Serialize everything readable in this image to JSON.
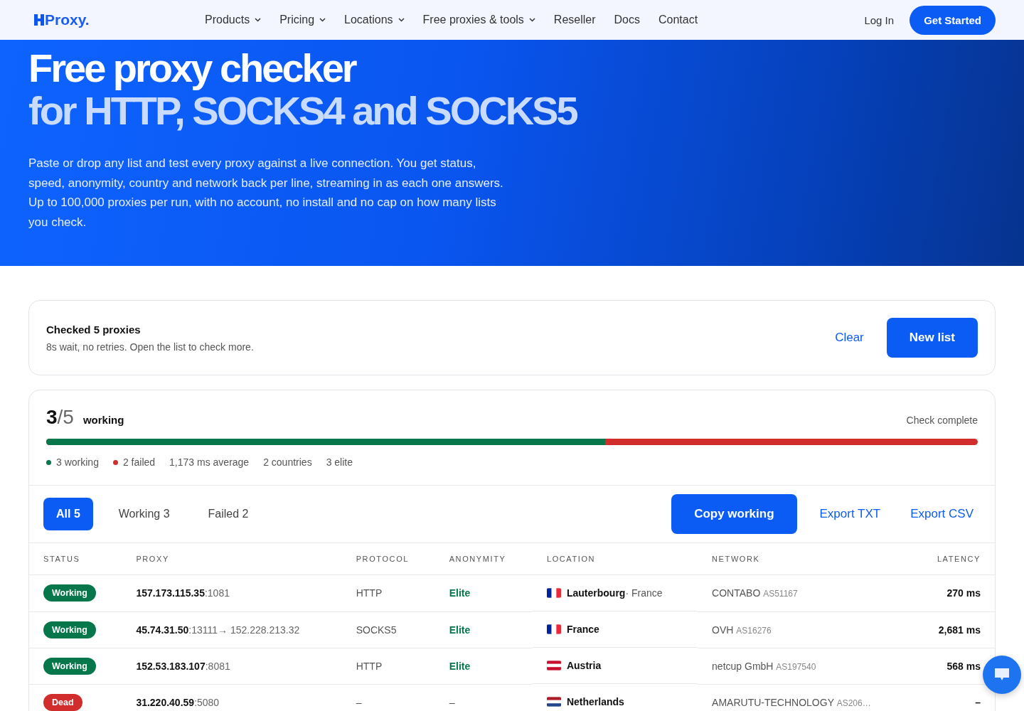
{
  "nav": {
    "logo": "Proxy.",
    "links": [
      {
        "label": "Products",
        "dropdown": true
      },
      {
        "label": "Pricing",
        "dropdown": true
      },
      {
        "label": "Locations",
        "dropdown": true
      },
      {
        "label": "Free proxies & tools",
        "dropdown": true
      },
      {
        "label": "Reseller",
        "dropdown": false
      },
      {
        "label": "Docs",
        "dropdown": false
      },
      {
        "label": "Contact",
        "dropdown": false
      }
    ],
    "login": "Log In",
    "cta": "Get Started"
  },
  "hero": {
    "title_line1": "Free proxy checker",
    "title_line2": "for HTTP, SOCKS4 and SOCKS5",
    "text": "Paste or drop any list and test every proxy against a live connection. You get status, speed, anonymity, country and network back per line, streaming in as each one answers. Up to 100,000 proxies per run, with no account, no install and no cap on how many lists you check."
  },
  "summary": {
    "title": "Checked 5 proxies",
    "subtitle": "8s wait, no retries. Open the list to check more.",
    "clear": "Clear",
    "new_list": "New list"
  },
  "results": {
    "count": "3",
    "total": "/5",
    "count_label": "working",
    "state": "Check complete",
    "level": 0.6,
    "stats": [
      {
        "text": "3 working",
        "color": "#06774a"
      },
      {
        "text": "2 failed",
        "color": "#d22d2d"
      },
      {
        "text": "1,173 ms average"
      },
      {
        "text": "2 countries"
      },
      {
        "text": "3 elite"
      }
    ],
    "filters": [
      {
        "label": "All 5",
        "selected": true
      },
      {
        "label": "Working 3",
        "selected": false
      },
      {
        "label": "Failed 2",
        "selected": false
      }
    ],
    "actions": [
      "Copy working",
      "Export TXT",
      "Export CSV"
    ],
    "columns": [
      "STATUS",
      "PROXY",
      "PROTOCOL",
      "ANONYMITY",
      "LOCATION",
      "NETWORK",
      "LATENCY"
    ],
    "rows": [
      {
        "status": "Working",
        "ok": true,
        "host": "157.173.115.35",
        "port": ":1081",
        "protocol": "HTTP",
        "anonymity": "Elite",
        "kind": "fr",
        "place": "Lauterbourg",
        "country": "· France",
        "network": "CONTABO",
        "asn": "AS51167",
        "latency": "270 ms"
      },
      {
        "status": "Working",
        "ok": true,
        "host": "45.74.31.50",
        "port": ":13111",
        "exit": "→ 152.228.213.32",
        "protocol": "SOCKS5",
        "anonymity": "Elite",
        "kind": "fr",
        "place": "France",
        "network": "OVH",
        "asn": "AS16276",
        "latency": "2,681 ms"
      },
      {
        "status": "Working",
        "ok": true,
        "host": "152.53.183.107",
        "port": ":8081",
        "protocol": "HTTP",
        "anonymity": "Elite",
        "kind": "at",
        "place": "Austria",
        "network": "netcup GmbH",
        "asn": "AS197540",
        "latency": "568 ms"
      },
      {
        "status": "Dead",
        "ok": false,
        "host": "31.220.40.59",
        "port": ":5080",
        "protocol": "–",
        "anonymity": "–",
        "kind": "nl",
        "place": "Netherlands",
        "network": "AMARUTU-TECHNOLOGY",
        "asn": "AS206…",
        "latency": "–"
      }
    ]
  }
}
